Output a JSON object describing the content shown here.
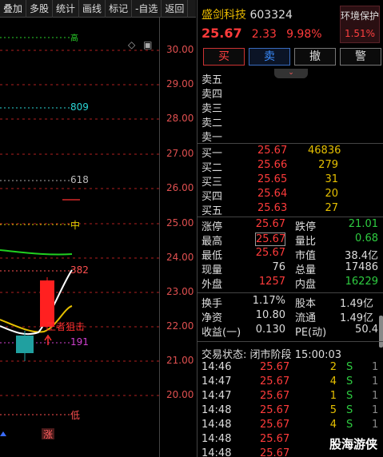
{
  "toolbar": [
    "叠加",
    "多股",
    "统计",
    "画线",
    "标记",
    "-自选",
    "返回"
  ],
  "chart": {
    "price_labels": [
      "30.00",
      "29.00",
      "28.00",
      "27.00",
      "26.00",
      "25.00",
      "24.00",
      "23.00",
      "22.00",
      "21.00",
      "20.00"
    ],
    "fib_labels": [
      {
        "text": "809",
        "color": "#2ad4d4"
      },
      {
        "text": "618",
        "color": "#bbbbbb"
      },
      {
        "text": "中",
        "color": "#e6d000"
      },
      {
        "text": "382",
        "color": "#ff5050"
      },
      {
        "text": "191",
        "color": "#d040d0"
      },
      {
        "text": "低",
        "color": "#ff5050"
      }
    ],
    "top_fib": "高",
    "annotation": "王者狙击",
    "limit_tag": "涨",
    "icons": [
      "diamond-icon",
      "layout-icon"
    ]
  },
  "stock": {
    "name": "盛剑科技",
    "code": "603324",
    "price": "25.67",
    "change": "2.33",
    "change_pct": "9.98%"
  },
  "env": {
    "title": "环境保护",
    "value": "1.51%"
  },
  "buttons": {
    "buy": "买",
    "sell": "卖",
    "cancel": "撤",
    "alert": "警"
  },
  "asks": [
    {
      "label": "卖五",
      "price": "",
      "vol": ""
    },
    {
      "label": "卖四",
      "price": "",
      "vol": ""
    },
    {
      "label": "卖三",
      "price": "",
      "vol": ""
    },
    {
      "label": "卖二",
      "price": "",
      "vol": ""
    },
    {
      "label": "卖一",
      "price": "",
      "vol": ""
    }
  ],
  "bids": [
    {
      "label": "买一",
      "price": "25.67",
      "vol": "46836"
    },
    {
      "label": "买二",
      "price": "25.66",
      "vol": "279"
    },
    {
      "label": "买三",
      "price": "25.65",
      "vol": "31"
    },
    {
      "label": "买四",
      "price": "25.64",
      "vol": "20"
    },
    {
      "label": "买五",
      "price": "25.63",
      "vol": "27"
    }
  ],
  "stats": [
    {
      "l1": "涨停",
      "v1": "25.67",
      "c1": "up",
      "l2": "跌停",
      "v2": "21.01",
      "c2": "dn"
    },
    {
      "l1": "最高",
      "v1": "25.67",
      "c1": "up",
      "l2": "量比",
      "v2": "0.68",
      "c2": "dn"
    },
    {
      "l1": "最低",
      "v1": "25.67",
      "c1": "up",
      "l2": "市值",
      "v2": "38.4亿",
      "c2": "wt"
    },
    {
      "l1": "现量",
      "v1": "76",
      "c1": "wt",
      "l2": "总量",
      "v2": "17486",
      "c2": "wt"
    },
    {
      "l1": "外盘",
      "v1": "1257",
      "c1": "up",
      "l2": "内盘",
      "v2": "16229",
      "c2": "dn"
    }
  ],
  "stats2": [
    {
      "l1": "换手",
      "v1": "1.17%",
      "l2": "股本",
      "v2": "1.49亿"
    },
    {
      "l1": "净资",
      "v1": "10.80",
      "l2": "流通",
      "v2": "1.49亿"
    },
    {
      "l1": "收益(一)",
      "v1": "0.130",
      "l2": "PE(动)",
      "v2": "50.4"
    }
  ],
  "status": {
    "label": "交易状态:",
    "phase": "闭市阶段",
    "time": "15:00:03"
  },
  "ticks": [
    {
      "time": "14:46",
      "price": "25.67",
      "vol": "2",
      "side": "S",
      "n": "1"
    },
    {
      "time": "14:47",
      "price": "25.67",
      "vol": "4",
      "side": "S",
      "n": "1"
    },
    {
      "time": "14:47",
      "price": "25.67",
      "vol": "1",
      "side": "S",
      "n": "1"
    },
    {
      "time": "14:48",
      "price": "25.67",
      "vol": "5",
      "side": "S",
      "n": "1"
    },
    {
      "time": "14:48",
      "price": "25.67",
      "vol": "4",
      "side": "S",
      "n": "1"
    },
    {
      "time": "14:48",
      "price": "25.67",
      "vol": "",
      "side": "",
      "n": ""
    },
    {
      "time": "14:48",
      "price": "25.67",
      "vol": "",
      "side": "",
      "n": ""
    }
  ],
  "watermark": "股海游侠",
  "colors": {
    "up": "#ff3b3b",
    "down": "#2ecc40",
    "yellow": "#e6c000",
    "background": "#000000"
  }
}
